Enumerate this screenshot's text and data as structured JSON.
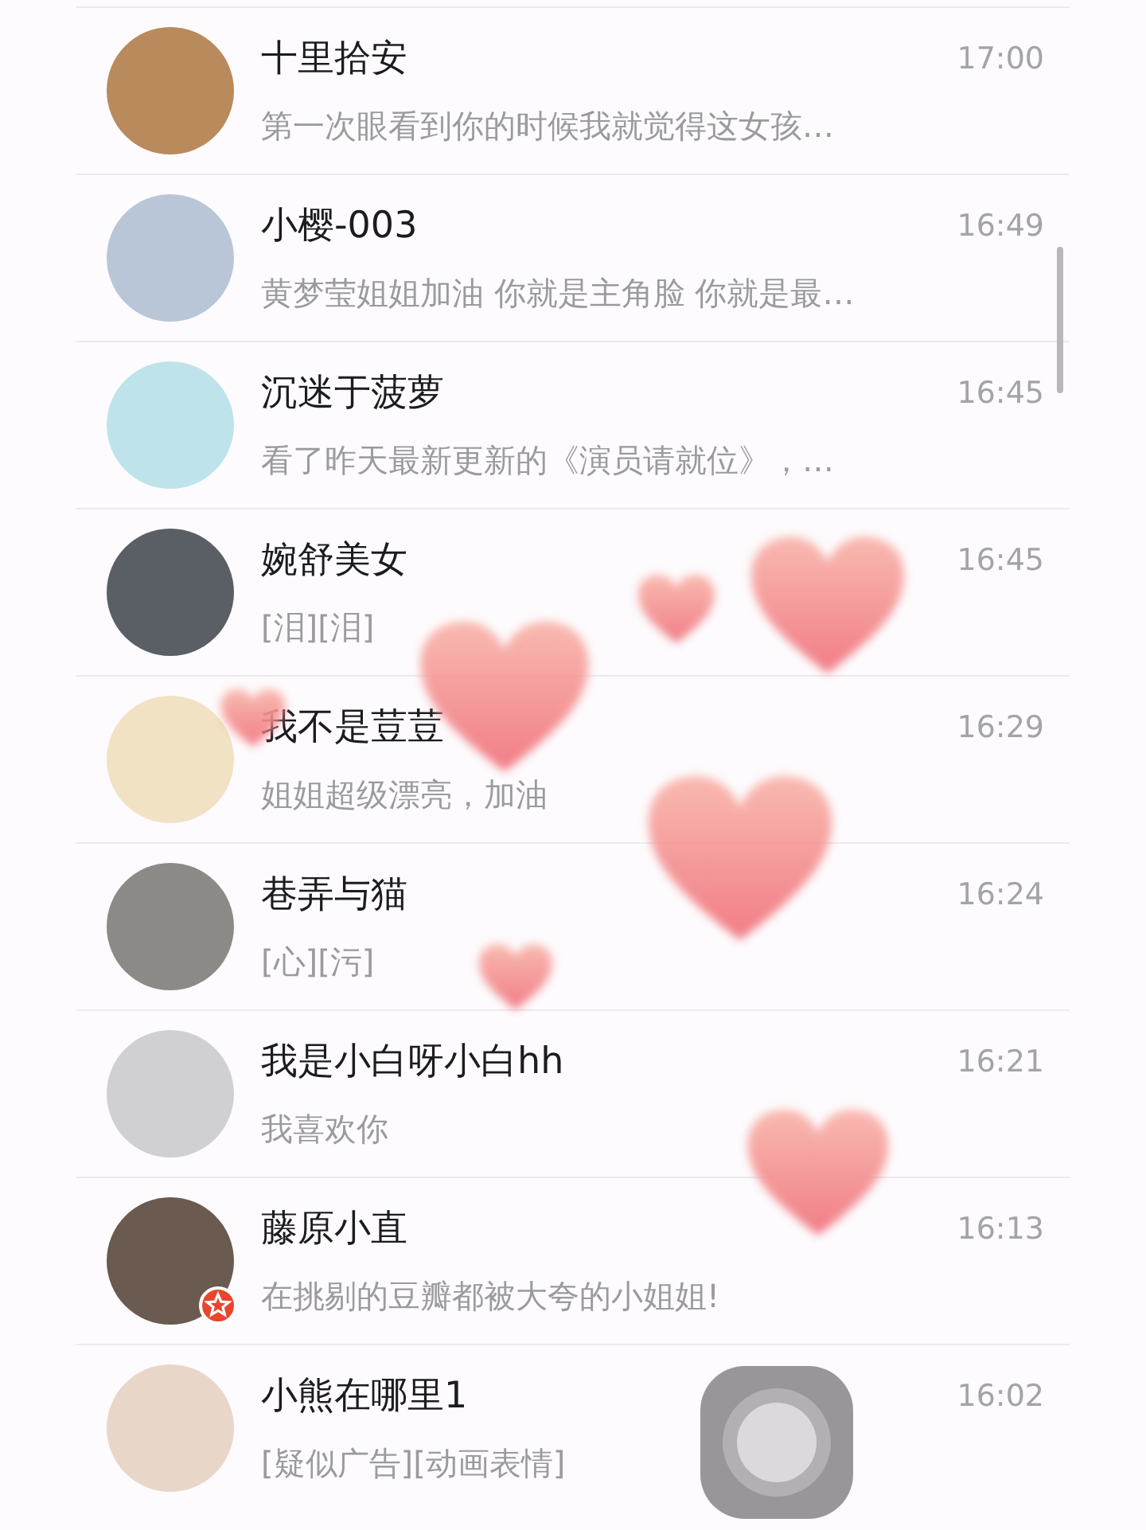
{
  "chats": [
    {
      "name": "十里拾安",
      "preview": "第一次眼看到你的时候我就觉得这女孩…",
      "time": "17:00",
      "badge": false
    },
    {
      "name": "小樱-003",
      "preview": "黄梦莹姐姐加油 你就是主角脸 你就是最…",
      "time": "16:49",
      "badge": false
    },
    {
      "name": "沉迷于菠萝",
      "preview": "看了昨天最新更新的《演员请就位》，…",
      "time": "16:45",
      "badge": false
    },
    {
      "name": "婉舒美女",
      "preview": "[泪][泪]",
      "time": "16:45",
      "badge": false
    },
    {
      "name": "我不是荳荳",
      "preview": "姐姐超级漂亮，加油",
      "time": "16:29",
      "badge": false
    },
    {
      "name": "巷弄与猫",
      "preview": "[心][污]",
      "time": "16:24",
      "badge": false
    },
    {
      "name": "我是小白呀小白hh",
      "preview": "我喜欢你",
      "time": "16:21",
      "badge": false
    },
    {
      "name": "藤原小直",
      "preview": "在挑剔的豆瓣都被大夸的小姐姐!",
      "time": "16:13",
      "badge": true
    },
    {
      "name": "小熊在哪里1",
      "preview": "[疑似广告][动画表情]",
      "time": "16:02",
      "badge": false
    }
  ]
}
